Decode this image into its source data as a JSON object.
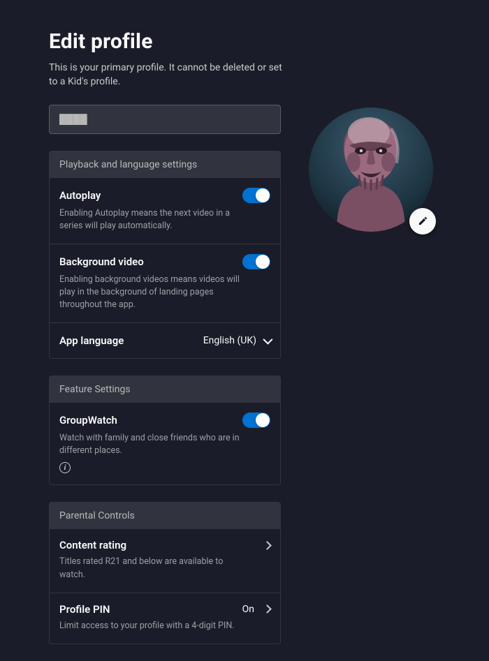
{
  "header": {
    "title": "Edit profile",
    "subtitle": "This is your primary profile. It cannot be deleted or set to a Kid's profile."
  },
  "profile": {
    "name_value": "████",
    "avatar_alt": "Profile avatar",
    "edit_icon": "pencil-icon"
  },
  "sections": {
    "playback": {
      "header": "Playback and language settings",
      "autoplay": {
        "label": "Autoplay",
        "desc": "Enabling Autoplay means the next video in a series will play automatically.",
        "on": true
      },
      "background_video": {
        "label": "Background video",
        "desc": "Enabling background videos means videos will play in the background of landing pages throughout the app.",
        "on": true
      },
      "app_language": {
        "label": "App language",
        "value": "English (UK)"
      }
    },
    "feature": {
      "header": "Feature Settings",
      "groupwatch": {
        "label": "GroupWatch",
        "desc": "Watch with family and close friends who are in different places.",
        "on": true
      }
    },
    "parental": {
      "header": "Parental Controls",
      "content_rating": {
        "label": "Content rating",
        "desc": "Titles rated R21 and below are available to watch."
      },
      "profile_pin": {
        "label": "Profile PIN",
        "value": "On",
        "desc": "Limit access to your profile with a 4-digit PIN."
      }
    }
  }
}
